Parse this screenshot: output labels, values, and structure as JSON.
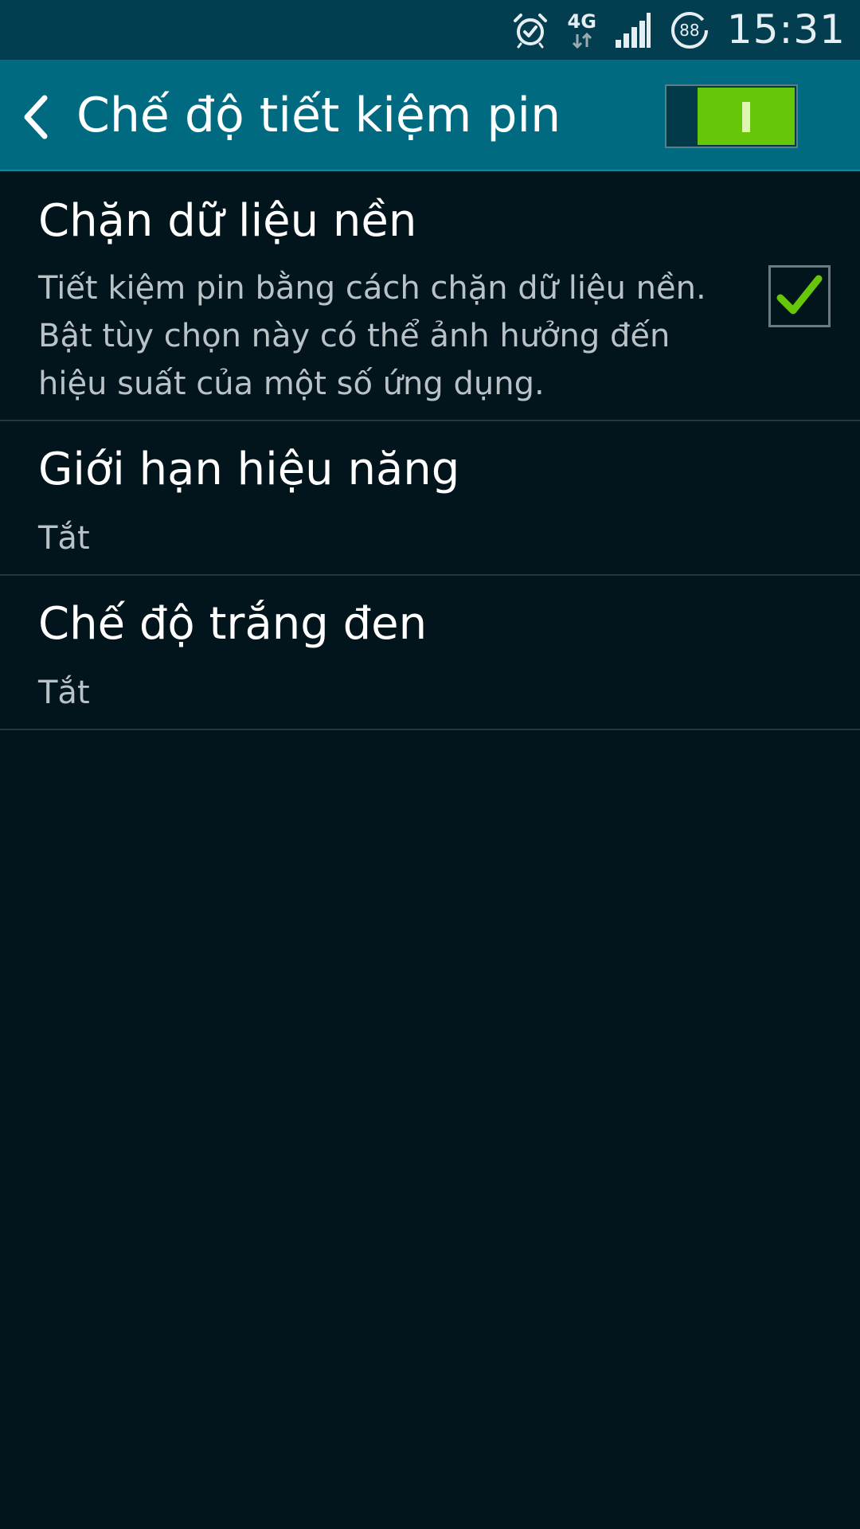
{
  "status_bar": {
    "time": "15:31",
    "network_type": "4G",
    "battery_level": "88",
    "icons": [
      "alarm-icon",
      "data-transfer-icon",
      "signal-icon",
      "battery-icon"
    ]
  },
  "header": {
    "title": "Chế độ tiết kiệm pin",
    "back_icon": "chevron-left-icon",
    "switch_state": "on"
  },
  "settings": [
    {
      "title": "Chặn dữ liệu nền",
      "summary": "Tiết kiệm pin bằng cách chặn dữ liệu nền. Bật tùy chọn này có thể ảnh hưởng đến hiệu suất của một số ứng dụng.",
      "checked": true
    },
    {
      "title": "Giới hạn hiệu năng",
      "summary": "Tắt"
    },
    {
      "title": "Chế độ trắng đen",
      "summary": "Tắt"
    }
  ],
  "colors": {
    "background": "#02141c",
    "status_bar": "#023e4f",
    "action_bar": "#006b80",
    "accent": "#66c60a",
    "divider": "#243740",
    "summary_text": "#b8c2c7"
  }
}
